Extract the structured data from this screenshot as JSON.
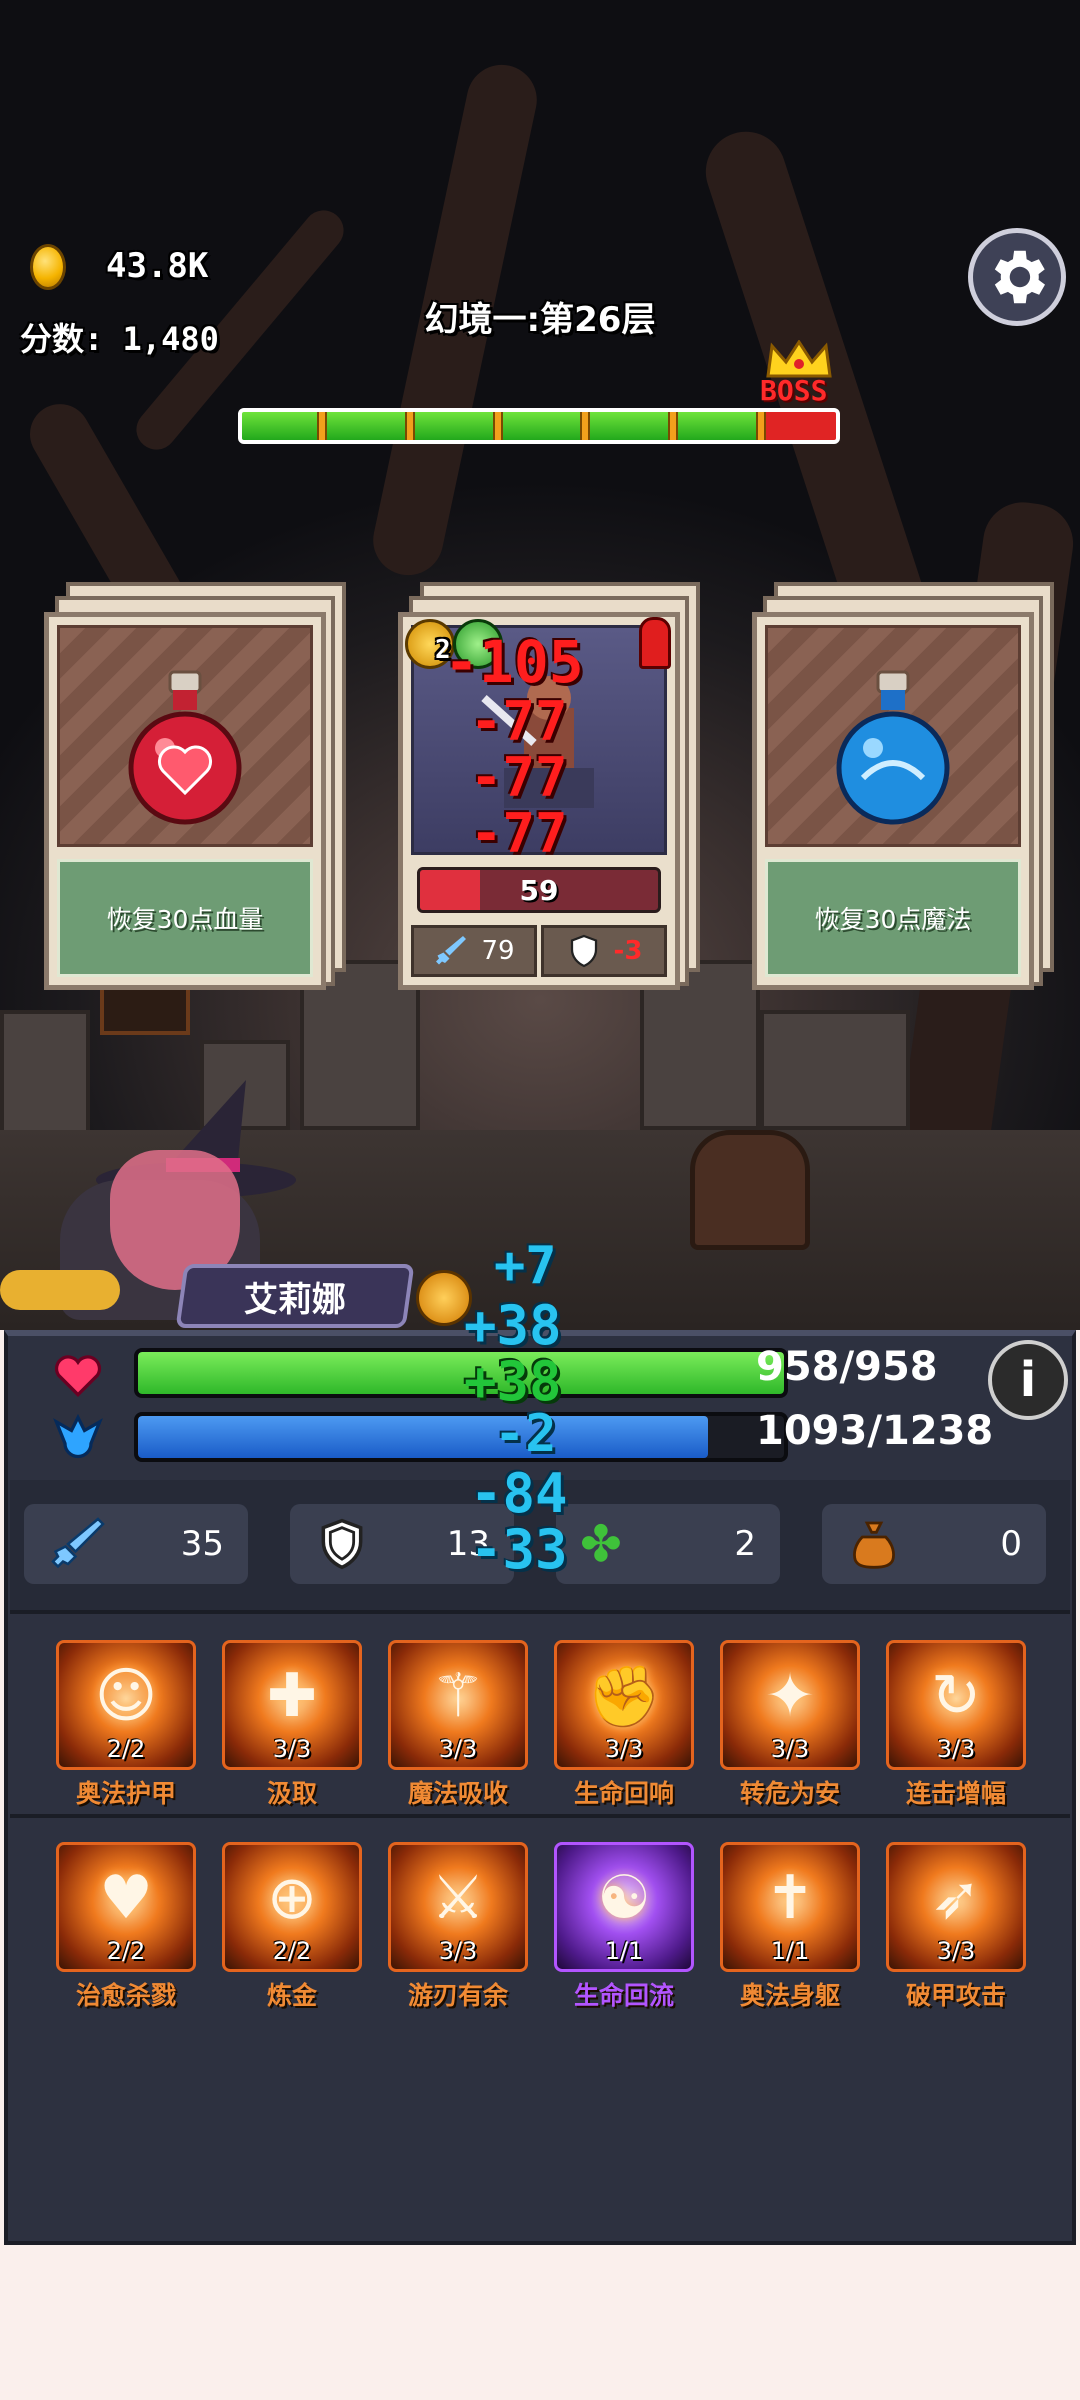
{
  "hud": {
    "coin_value": "43.8K",
    "score_text": "分数: 1,480",
    "floor_title": "幻境一:第26层",
    "boss_label": "BOSS",
    "progress": 0.87
  },
  "cards": {
    "left": {
      "description": "恢复30点血量"
    },
    "enemy": {
      "hp": "59",
      "hp_fraction": 0.25,
      "attack": "79",
      "defense": "-3",
      "damage_texts": [
        "-105",
        "-77",
        "-77",
        "-77"
      ],
      "small_value": "2"
    },
    "right": {
      "description": "恢复30点魔法"
    }
  },
  "hero": {
    "name": "艾莉娜",
    "float_texts": [
      "+7",
      "+38",
      "+38",
      "-2",
      "-84",
      "-33"
    ]
  },
  "player": {
    "hp": "958/958",
    "hp_fraction": 1.0,
    "mp": "1093/1238",
    "mp_fraction": 0.883,
    "info_label": "i"
  },
  "stats": [
    {
      "icon": "sword-icon",
      "value": "35"
    },
    {
      "icon": "shield-icon",
      "value": "13"
    },
    {
      "icon": "clover-icon",
      "value": "2"
    },
    {
      "icon": "money-bag-icon",
      "value": "0"
    }
  ],
  "skills": [
    {
      "name": "奥法护甲",
      "count": "2/2",
      "glyph": "☺",
      "purple": false
    },
    {
      "name": "汲取",
      "count": "3/3",
      "glyph": "✚",
      "purple": false
    },
    {
      "name": "魔法吸收",
      "count": "3/3",
      "glyph": "⚚",
      "purple": false
    },
    {
      "name": "生命回响",
      "count": "3/3",
      "glyph": "✊",
      "purple": false
    },
    {
      "name": "转危为安",
      "count": "3/3",
      "glyph": "✦",
      "purple": false
    },
    {
      "name": "连击增幅",
      "count": "3/3",
      "glyph": "↻",
      "purple": false
    },
    {
      "name": "治愈杀戮",
      "count": "2/2",
      "glyph": "♥",
      "purple": false
    },
    {
      "name": "炼金",
      "count": "2/2",
      "glyph": "⊕",
      "purple": false
    },
    {
      "name": "游刃有余",
      "count": "3/3",
      "glyph": "⚔",
      "purple": false
    },
    {
      "name": "生命回流",
      "count": "1/1",
      "glyph": "☯",
      "purple": true
    },
    {
      "name": "奥法身躯",
      "count": "1/1",
      "glyph": "✝",
      "purple": false
    },
    {
      "name": "破甲攻击",
      "count": "3/3",
      "glyph": "➶",
      "purple": false
    }
  ],
  "colors": {
    "hp_bar": "#3fd43a",
    "mp_bar": "#1e66d8",
    "skill_orange": "#f08a34",
    "skill_purple": "#b255ff",
    "damage_red": "#ff1e1e",
    "heal_cyan": "#28c3f0"
  }
}
